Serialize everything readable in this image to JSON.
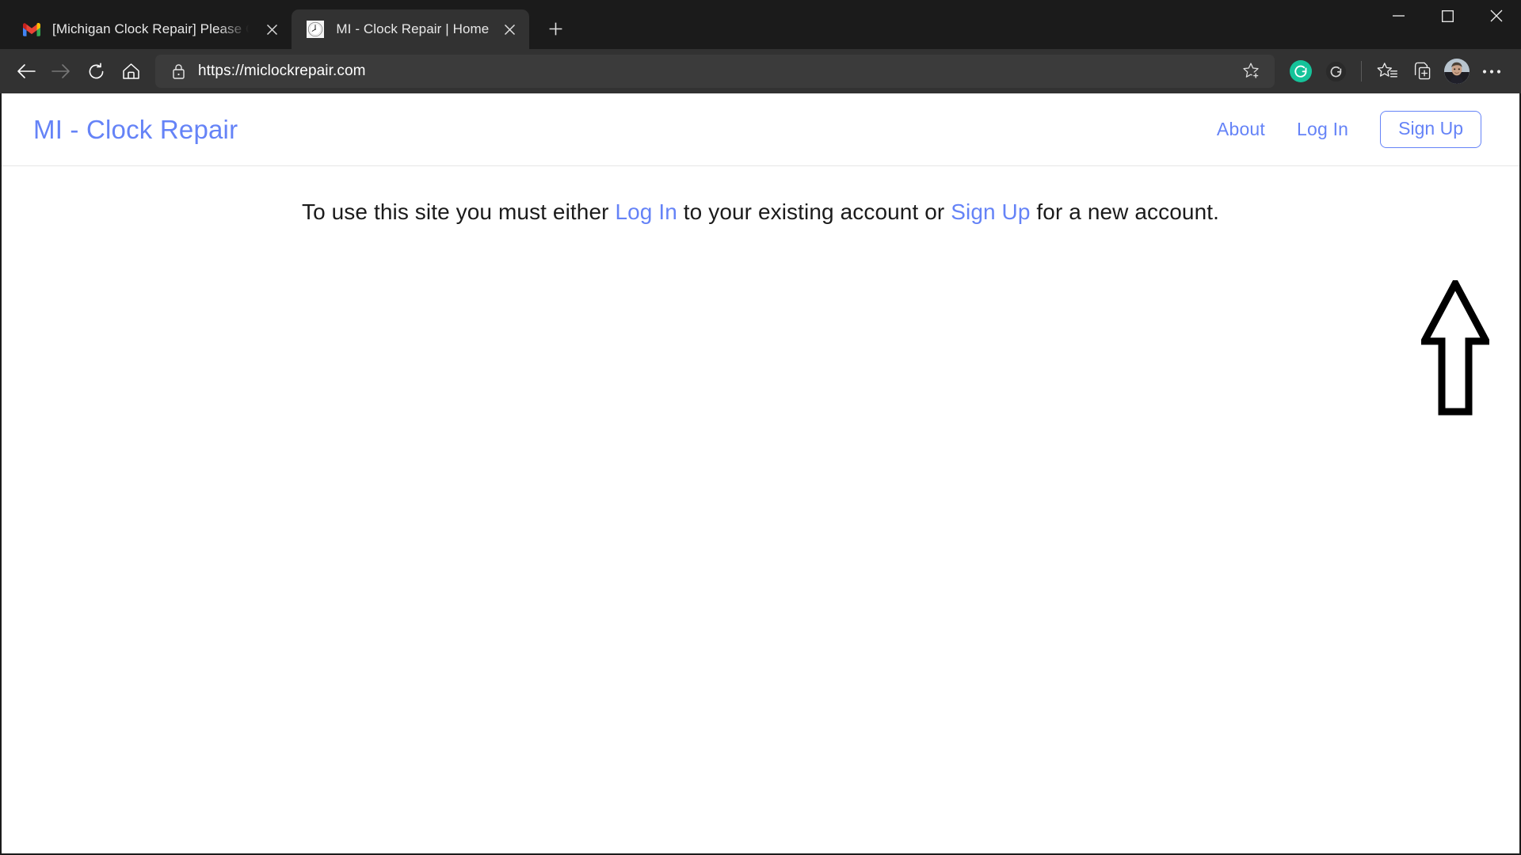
{
  "browser": {
    "tabs": [
      {
        "title": "[Michigan Clock Repair] Please C",
        "favicon": "gmail-icon",
        "active": false
      },
      {
        "title": "MI - Clock Repair | Home",
        "favicon": "clock-icon",
        "active": true
      }
    ],
    "new_tab_label": "+",
    "window_controls": {
      "minimize": "minimize-icon",
      "maximize": "maximize-icon",
      "close": "close-icon"
    },
    "nav_buttons": {
      "back": "back-arrow-icon",
      "forward": "forward-arrow-icon",
      "refresh": "refresh-icon",
      "home": "home-icon"
    },
    "address_bar": {
      "url": "https://miclockrepair.com",
      "lock": "lock-icon",
      "add_favorite": "star-plus-icon"
    },
    "toolbar_icons": [
      "grammarly-active-icon",
      "grammarly-icon",
      "favorites-icon",
      "collections-icon",
      "profile-avatar",
      "settings-more-icon"
    ]
  },
  "site": {
    "brand": "MI - Clock Repair",
    "nav": [
      {
        "label": "About",
        "type": "link"
      },
      {
        "label": "Log In",
        "type": "link"
      },
      {
        "label": "Sign Up",
        "type": "button"
      }
    ],
    "message": {
      "part1": "To use this site you must either ",
      "link1": "Log In",
      "part2": " to your existing account or ",
      "link2": "Sign Up",
      "part3": " for a new account."
    }
  },
  "annotation": {
    "arrow": "up-arrow-annotation",
    "points_to": "Sign Up"
  },
  "colors": {
    "accent_blue": "#6583f7",
    "browser_chrome": "#323232",
    "tab_strip": "#1b1b1b",
    "page_bg": "#ffffff",
    "grammarly_green": "#15c39a"
  }
}
